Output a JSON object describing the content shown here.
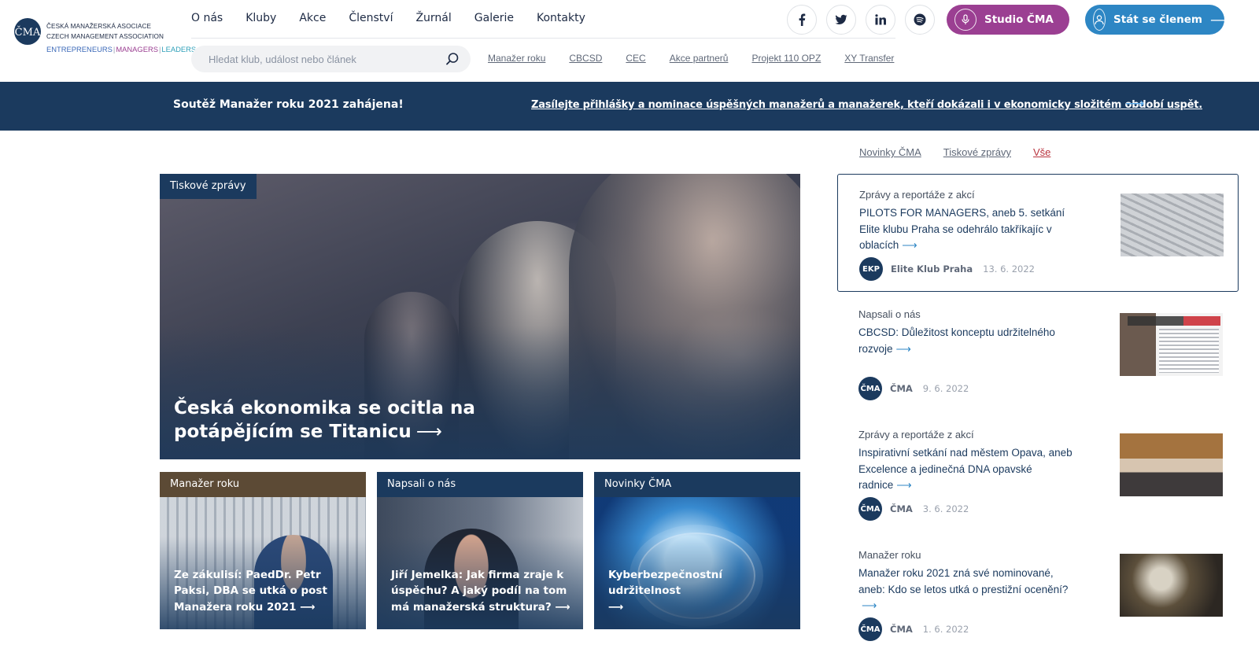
{
  "logo": {
    "line1": "ČESKÁ MANAŽERSKÁ ASOCIACE",
    "line2": "CZECH MANAGEMENT ASSOCIATION",
    "tag1": "ENTREPRENEURS",
    "tag2": "MANAGERS",
    "tag3": "LEADERS"
  },
  "nav": [
    "O nás",
    "Kluby",
    "Akce",
    "Členství",
    "Žurnál",
    "Galerie",
    "Kontakty"
  ],
  "search": {
    "placeholder": "Hledat klub, událost nebo článek"
  },
  "sublinks": [
    "Manažer roku",
    "CBCSD",
    "CEC",
    "Akce partnerů",
    "Projekt 110 OPZ",
    "XY Transfer"
  ],
  "socials": [
    "facebook-icon",
    "twitter-icon",
    "linkedin-icon",
    "spotify-icon"
  ],
  "buttons": {
    "studio": "Studio ČMA",
    "member": "Stát se členem"
  },
  "colors": {
    "navy": "#1b3a5e",
    "studio": "#9b3f92",
    "member": "#2d86c4",
    "accent_red": "#b9343e"
  },
  "banner": {
    "title": "Soutěž Manažer roku 2021 zahájena!",
    "link": "Zasílejte přihlášky a nominace úspěšných manažerů a manažerek, kteří dokázali i v ekonomicky složitém období uspět."
  },
  "hero": {
    "badge": "Tiskové zprávy",
    "title": "Česká ekonomika se ocitla na potápějícím se Titanicu"
  },
  "cards": [
    {
      "badge": "Manažer roku",
      "title": "Ze zákulisí: PaedDr. Petr Paksi, DBA se utká o post Manažera roku 2021"
    },
    {
      "badge": "Napsali o nás",
      "title": "Jiří Jemelka: Jak firma zraje k úspěchu? A jaký podíl na tom má manažerská struktura?"
    },
    {
      "badge": "Novinky ČMA",
      "title": "Kyberbezpečnostní udržitelnost"
    }
  ],
  "tabs": [
    "Novinky ČMA",
    "Tiskové zprávy",
    "Vše"
  ],
  "news": [
    {
      "category": "Zprávy a reportáže z akcí",
      "title": "PILOTS FOR MANAGERS, aneb 5. setkání Elite klubu Praha se odehrálo takříkajíc v oblacích",
      "avatar": "EKP",
      "author": "Elite Klub Praha",
      "date": "13. 6. 2022"
    },
    {
      "category": "Napsali o nás",
      "title": "CBCSD: Důležitost konceptu udržitelného rozvoje",
      "avatar": "ČMA",
      "author": "ČMA",
      "date": "9. 6. 2022"
    },
    {
      "category": "Zprávy a reportáže z akcí",
      "title": "Inspirativní setkání nad městem Opava, aneb Excelence a jedinečná DNA opavské radnice",
      "avatar": "ČMA",
      "author": "ČMA",
      "date": "3. 6. 2022"
    },
    {
      "category": "Manažer roku",
      "title": "Manažer roku 2021 zná své nominované, aneb: Kdo se letos utká o prestižní ocenění?",
      "avatar": "ČMA",
      "author": "ČMA",
      "date": "1. 6. 2022"
    }
  ]
}
